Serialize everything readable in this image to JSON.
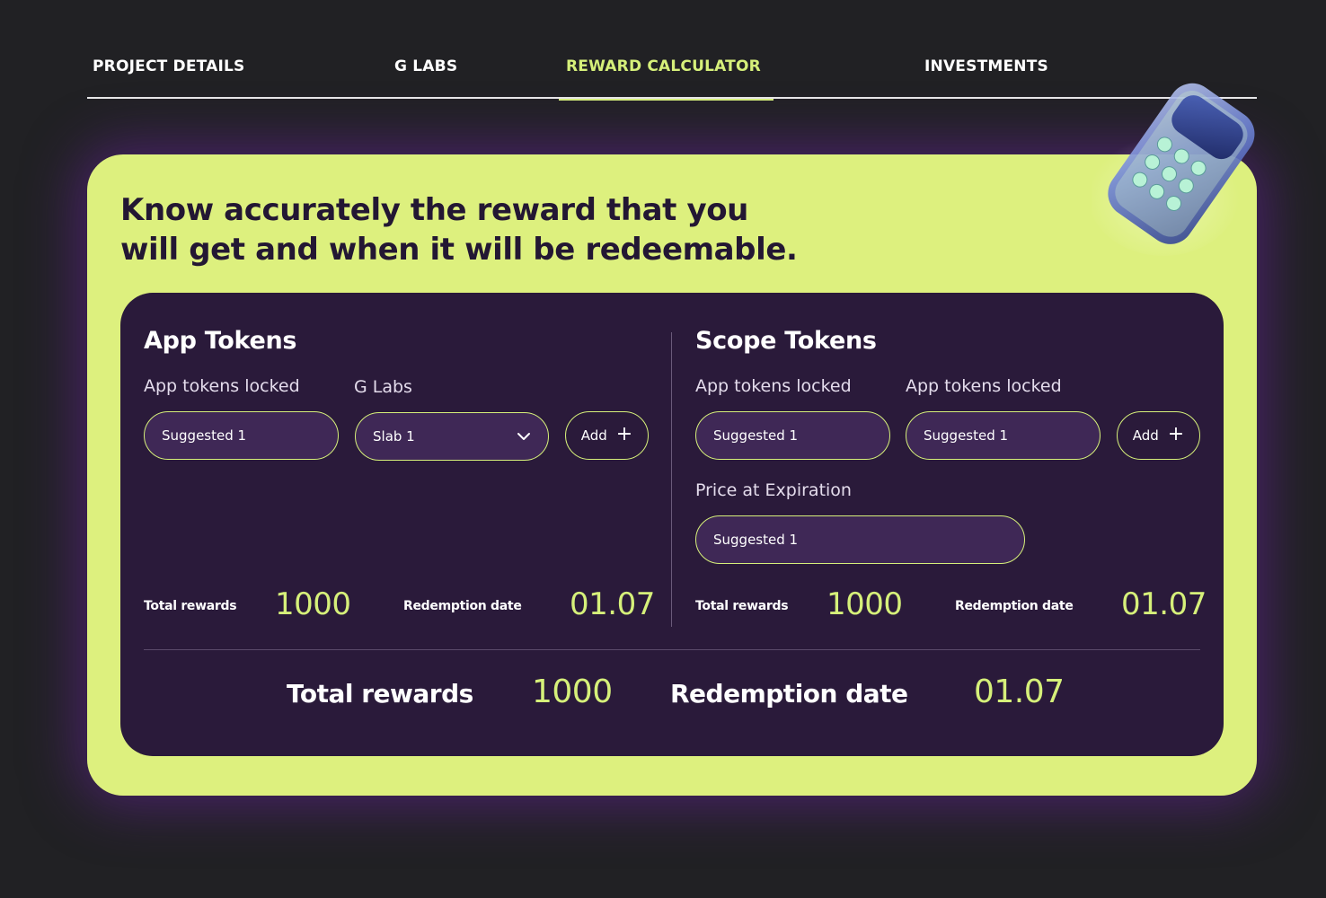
{
  "tabs": [
    {
      "label": "PROJECT DETAILS",
      "active": false
    },
    {
      "label": "G LABS",
      "active": false
    },
    {
      "label": "REWARD CALCULATOR",
      "active": true
    },
    {
      "label": "INVESTMENTS",
      "active": false
    }
  ],
  "hero": {
    "headline_line1": "Know accurately the reward that you",
    "headline_line2": "will get and when it will be redeemable.",
    "illustration_icon": "calculator-icon"
  },
  "app_tokens": {
    "title": "App Tokens",
    "locked_label": "App tokens locked",
    "locked_value": "Suggested 1",
    "glabs_label": "G Labs",
    "glabs_selected": "Slab 1",
    "add_label": "Add",
    "total_rewards_label": "Total rewards",
    "total_rewards_value": "1000",
    "redemption_label": "Redemption date",
    "redemption_value": "01.07"
  },
  "scope_tokens": {
    "title": "Scope Tokens",
    "locked_label_1": "App tokens locked",
    "locked_value_1": "Suggested 1",
    "locked_label_2": "App tokens locked",
    "locked_value_2": "Suggested 1",
    "add_label": "Add",
    "price_label": "Price at Expiration",
    "price_value": "Suggested 1",
    "total_rewards_label": "Total rewards",
    "total_rewards_value": "1000",
    "redemption_label": "Redemption date",
    "redemption_value": "01.07"
  },
  "summary": {
    "total_rewards_label": "Total rewards",
    "total_rewards_value": "1000",
    "redemption_label": "Redemption date",
    "redemption_value": "01.07"
  },
  "colors": {
    "background": "#212124",
    "accent_lime": "#d6f07a",
    "hero_card": "#ddf07e",
    "panel": "#2a1a3a",
    "input_fill": "#3f2856",
    "headline_text": "#231733"
  }
}
